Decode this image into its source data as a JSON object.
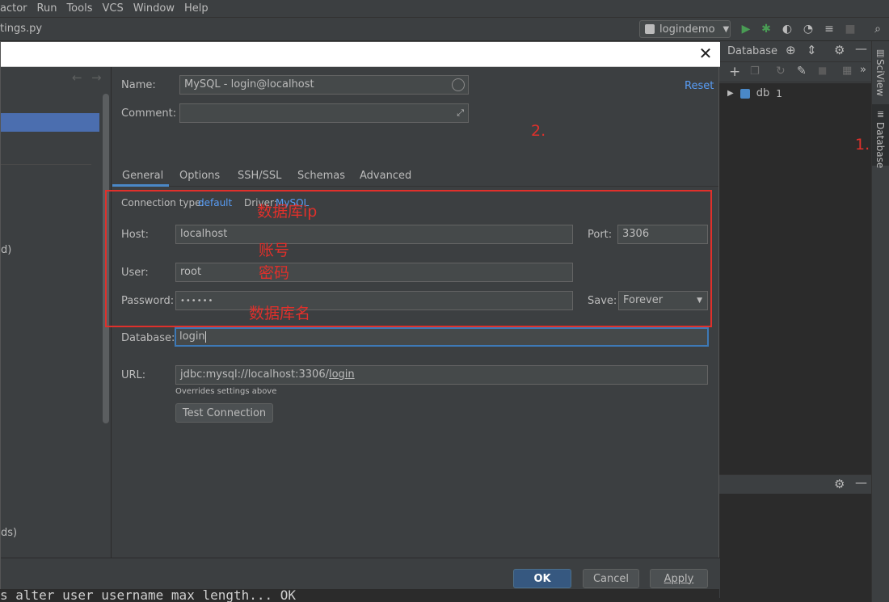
{
  "menu": [
    "actor",
    "Run",
    "Tools",
    "VCS",
    "Window",
    "Help"
  ],
  "file_tab": "tings.py",
  "run_config": "logindemo",
  "db_panel": {
    "title": "Database",
    "tree_item": "db",
    "tree_count": "1"
  },
  "right_stripe": {
    "sciview": "SciView",
    "database": "Database"
  },
  "left_pane": {
    "item_a": "d)",
    "item_b": "ds)"
  },
  "form": {
    "name_label": "Name:",
    "name_value": "MySQL - login@localhost",
    "comment_label": "Comment:",
    "reset": "Reset",
    "tabs": [
      "General",
      "Options",
      "SSH/SSL",
      "Schemas",
      "Advanced"
    ],
    "conn_type_label": "Connection type:",
    "conn_type_value": "default",
    "driver_label": "Driver:",
    "driver_value": "MySQL",
    "host_label": "Host:",
    "host_value": "localhost",
    "port_label": "Port:",
    "port_value": "3306",
    "user_label": "User:",
    "user_value": "root",
    "password_label": "Password:",
    "password_value": "••••••",
    "save_label": "Save:",
    "save_value": "Forever",
    "database_label": "Database:",
    "database_value": "login",
    "url_label": "URL:",
    "url_prefix": "jdbc:mysql://localhost:3306/",
    "url_db": "login",
    "url_hint": "Overrides settings above",
    "test_connection": "Test Connection"
  },
  "annotations": {
    "num1": "1.",
    "num2": "2.",
    "host": "数据库ip",
    "user": "账号",
    "password": "密码",
    "database": "数据库名"
  },
  "footer": {
    "ok": "OK",
    "cancel": "Cancel",
    "apply": "Apply"
  },
  "console": "s alter user username max length... OK",
  "colors": {
    "accent": "#4b6eaf",
    "annotation_red": "#e0302b",
    "link": "#589df6"
  }
}
